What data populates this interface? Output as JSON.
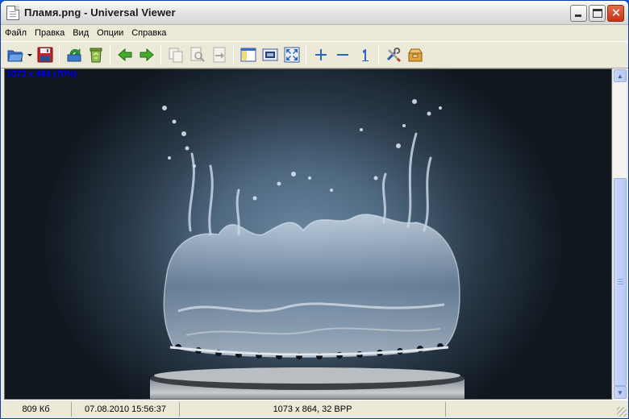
{
  "window": {
    "title": "Пламя.png - Universal Viewer"
  },
  "menu": {
    "items": [
      "Файл",
      "Правка",
      "Вид",
      "Опции",
      "Справка"
    ]
  },
  "toolbar": {
    "buttons": [
      "open-file",
      "open-dropdown",
      "save",
      "reload",
      "delete",
      "previous-file",
      "next-file",
      "copy",
      "find",
      "goto",
      "panel",
      "fit-image",
      "fullscreen",
      "zoom-in",
      "zoom-out",
      "zoom-original",
      "options",
      "plugins"
    ]
  },
  "viewer": {
    "info_label": "1073 x 864 (70%)"
  },
  "status": {
    "file_size": "809 Кб",
    "date": "07.08.2010 15:56:37",
    "image_info": "1073 x 864, 32 BPP"
  },
  "colors": {
    "info_label": "#0000ff",
    "title_close": "#c53414"
  }
}
